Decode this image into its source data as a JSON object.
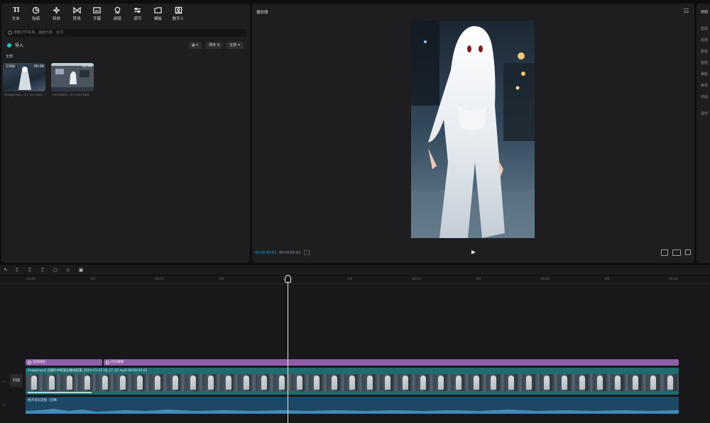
{
  "toolbar": {
    "items": [
      {
        "label": "文本",
        "icon": "TI"
      },
      {
        "label": "贴纸",
        "icon": "sticker"
      },
      {
        "label": "特效",
        "icon": "sparkle"
      },
      {
        "label": "转场",
        "icon": "bowtie"
      },
      {
        "label": "字幕",
        "icon": "caption"
      },
      {
        "label": "滤镜",
        "icon": "filter"
      },
      {
        "label": "调节",
        "icon": "sliders"
      },
      {
        "label": "模板",
        "icon": "template"
      },
      {
        "label": "数字人",
        "icon": "avatar"
      }
    ]
  },
  "media": {
    "search_placeholder": "搜索文件名称、画面元素、台词",
    "import_label": "导入",
    "view_btn": "",
    "sort_btn": "排序",
    "filter_btn": "全部",
    "section_label": "全部",
    "clips": [
      {
        "added": "已添加",
        "duration": "00:06",
        "name": "imageinpu...17_42.mp4"
      },
      {
        "added": "",
        "duration": "00:04",
        "name": "handsom...4-7-20.mp4"
      }
    ]
  },
  "player": {
    "title": "播放器",
    "current_time": "00:00:00:01",
    "total_time": "00:00:05:02"
  },
  "right_panel": {
    "items": [
      "画面",
      "基础",
      "抠像",
      "蒙版",
      "智能",
      "美颜",
      "美体",
      "动画",
      "调节"
    ]
  },
  "timeline": {
    "ruler": [
      "00:00",
      "1f0",
      "00:01",
      "1f0",
      "00:02",
      "1f0",
      "00:03",
      "1f0",
      "00:04",
      "1f0",
      "00:05"
    ],
    "cover_label": "封面",
    "fx_tracks": [
      {
        "label": "氛围拼贴"
      },
      {
        "label": "闪光模糊"
      }
    ],
    "video_clip_label": "imageinput 让图片中的美女舞动起来_2024-11-23 18_17_42.mp4  00:00:05:02",
    "audio_clip_label": "原声音乐音频（已降）"
  },
  "colors": {
    "accent": "#21c5c5",
    "timecode": "#1ba6d1",
    "fx_track": "#8f5fa6",
    "video_track": "#1f6b6f",
    "audio_track": "#1c4866"
  }
}
